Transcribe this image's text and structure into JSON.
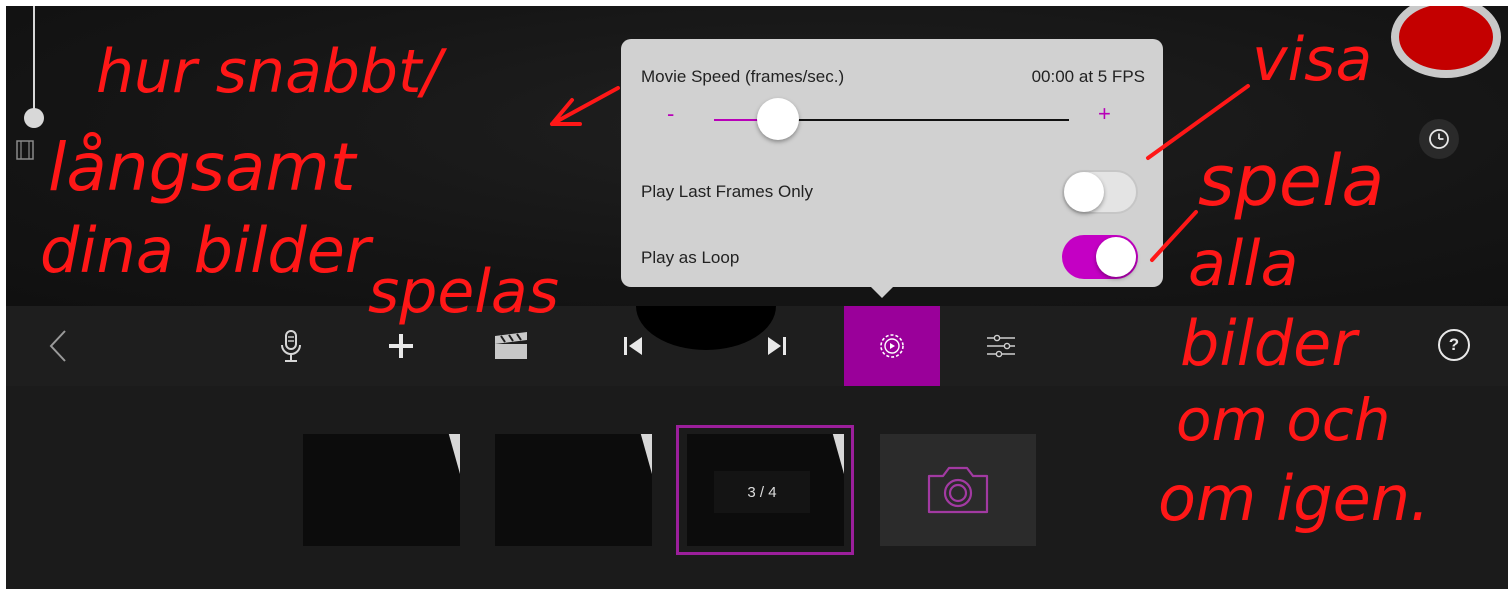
{
  "popover": {
    "title": "Movie Speed (frames/sec.)",
    "timecode": "00:00 at 5 FPS",
    "minus": "-",
    "plus": "+",
    "speed_slider_fraction": 0.18,
    "rows": [
      {
        "label": "Play Last Frames Only",
        "on": false
      },
      {
        "label": "Play as Loop",
        "on": true
      }
    ]
  },
  "toolbar": {
    "back_icon": "chevron-left-icon",
    "buttons": [
      {
        "icon": "microphone-icon"
      },
      {
        "icon": "plus-icon"
      },
      {
        "icon": "clapperboard-icon"
      },
      {
        "icon": "skip-back-icon"
      },
      {
        "icon": "skip-forward-icon"
      },
      {
        "icon": "playback-settings-icon",
        "active": true
      },
      {
        "icon": "adjust-sliders-icon"
      }
    ],
    "help_label": "?"
  },
  "filmstrip": {
    "counter": "3 / 4",
    "capture_icon": "camera-icon"
  },
  "record": {
    "icon": "record-icon"
  },
  "timer": {
    "icon": "clock-icon"
  },
  "colors": {
    "accent": "#b800b8",
    "record": "#c40000",
    "annotation": "#ff1717"
  },
  "annotations": [
    "hur snabbt/",
    "långsamt",
    "dina bilder",
    "spelas",
    "visa",
    "spela",
    "alla",
    "bilder",
    "om och",
    "om igen."
  ]
}
